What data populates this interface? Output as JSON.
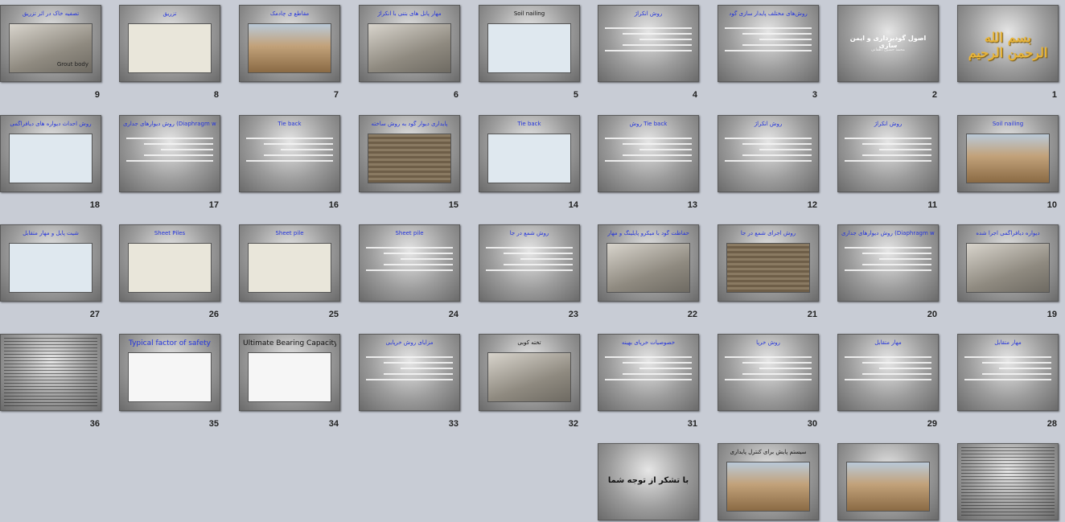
{
  "slides": [
    {
      "n": "1",
      "kind": "logo",
      "title": "",
      "logo": "بسم الله الرحمن الرحیم"
    },
    {
      "n": "2",
      "kind": "titleslide",
      "title": "اصول گودبرداری و ایمن سازی",
      "subtitle": "محمد حسین دهقانی"
    },
    {
      "n": "3",
      "kind": "bullets",
      "title": "روش‌های مختلف پایدار سازی گود"
    },
    {
      "n": "4",
      "kind": "bullets",
      "title": "روش انکراژ"
    },
    {
      "n": "5",
      "kind": "diagram",
      "title": "Soil nailing",
      "titleDark": true
    },
    {
      "n": "6",
      "kind": "photo-gray",
      "title": "مهار پانل های بتنی با انکراژ"
    },
    {
      "n": "7",
      "kind": "photo-earth",
      "title": "مقاطع ی چادمک"
    },
    {
      "n": "8",
      "kind": "diagram2",
      "title": "تزریق"
    },
    {
      "n": "9",
      "kind": "photo-gray",
      "title": "تصفیه خاک در اثر تزریق",
      "caption": "Grout body"
    },
    {
      "n": "10",
      "kind": "photo-earth",
      "title": "Soil nailing"
    },
    {
      "n": "11",
      "kind": "bullets",
      "title": "روش انکراژ"
    },
    {
      "n": "12",
      "kind": "bullets",
      "title": "روش انکراژ"
    },
    {
      "n": "13",
      "kind": "bullets",
      "title": "روش Tie back"
    },
    {
      "n": "14",
      "kind": "diagram",
      "title": "Tie back"
    },
    {
      "n": "15",
      "kind": "photo-wall",
      "title": "پایداری دیوار گود به روش ساخته"
    },
    {
      "n": "16",
      "kind": "bullets",
      "title": "Tie back"
    },
    {
      "n": "17",
      "kind": "bullets",
      "title": "روش دیوارهای جداری (Diaphragm wall)"
    },
    {
      "n": "18",
      "kind": "diagram",
      "title": "روش احداث دیواره های دیافراگمی"
    },
    {
      "n": "19",
      "kind": "photo-gray",
      "title": "دیواره دیافراگمی اجرا شده"
    },
    {
      "n": "20",
      "kind": "bullets",
      "title": "روش دیوارهای جداری (Diaphragm wall)"
    },
    {
      "n": "21",
      "kind": "photo-wall",
      "title": "روش اجرای شمع در جا"
    },
    {
      "n": "22",
      "kind": "photo-gray",
      "title": "حفاظت گود با میکرو پایلینگ و مهار"
    },
    {
      "n": "23",
      "kind": "bullets",
      "title": "روش شمع در جا"
    },
    {
      "n": "24",
      "kind": "bullets",
      "title": "Sheet pile"
    },
    {
      "n": "25",
      "kind": "diagram2",
      "title": "Sheet pile"
    },
    {
      "n": "26",
      "kind": "diagram2",
      "title": "Sheet Piles"
    },
    {
      "n": "27",
      "kind": "diagram",
      "title": "شیت پایل و مهار متقابل"
    },
    {
      "n": "28",
      "kind": "bullets",
      "title": "مهار متقابل"
    },
    {
      "n": "29",
      "kind": "bullets",
      "title": "مهار متقابل"
    },
    {
      "n": "30",
      "kind": "bullets",
      "title": "روش خرپا"
    },
    {
      "n": "31",
      "kind": "bullets",
      "title": "خصوصیات خرپای بهینه"
    },
    {
      "n": "32",
      "kind": "photo-gray",
      "title": "تخته کوبی",
      "titleDark": true
    },
    {
      "n": "33",
      "kind": "bullets",
      "title": "مزایای روش خرپایی"
    },
    {
      "n": "34",
      "kind": "doc",
      "title": "Ultimate Bearing Capacity.",
      "titleDark": true
    },
    {
      "n": "35",
      "kind": "doc",
      "title": "Typical factor of safety"
    },
    {
      "n": "36",
      "kind": "textblock",
      "title": ""
    },
    {
      "n": "",
      "kind": "textblock",
      "title": ""
    },
    {
      "n": "",
      "kind": "photo-earth",
      "title": ""
    },
    {
      "n": "",
      "kind": "photo-earth",
      "title": "سیستم پایش برای کنترل پایداری",
      "titleDark": true
    },
    {
      "n": "",
      "kind": "thanks",
      "title": "",
      "thanks": "با تشکر از توجه شما"
    }
  ]
}
